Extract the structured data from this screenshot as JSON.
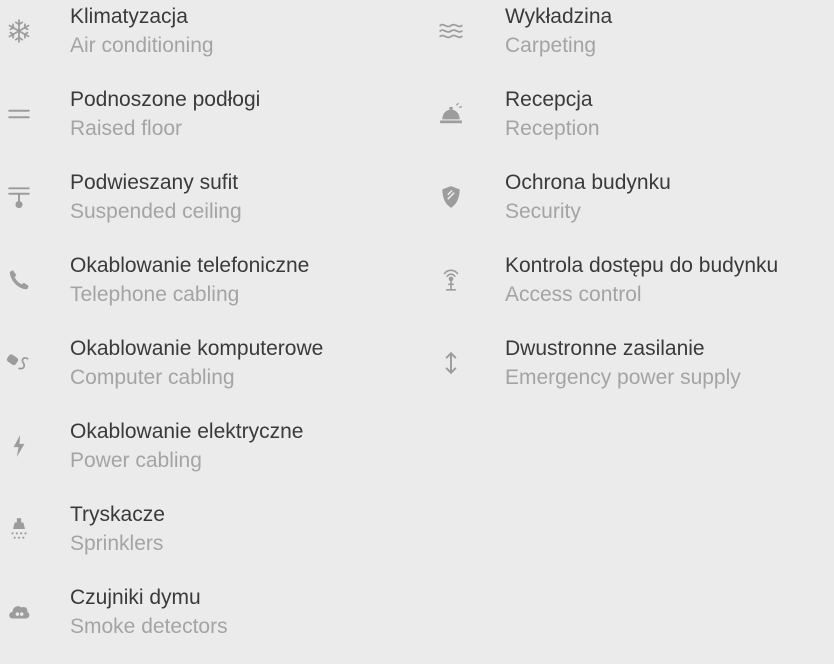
{
  "features_left": [
    {
      "pl": "Klimatyzacja",
      "en": "Air conditioning",
      "icon": "snowflake-icon"
    },
    {
      "pl": "Podnoszone podłogi",
      "en": "Raised floor",
      "icon": "raised-floor-icon"
    },
    {
      "pl": "Podwieszany sufit",
      "en": "Suspended ceiling",
      "icon": "suspended-ceiling-icon"
    },
    {
      "pl": "Okablowanie telefoniczne",
      "en": "Telephone cabling",
      "icon": "phone-icon"
    },
    {
      "pl": "Okablowanie komputerowe",
      "en": "Computer cabling",
      "icon": "network-cable-icon"
    },
    {
      "pl": "Okablowanie elektryczne",
      "en": "Power cabling",
      "icon": "lightning-icon"
    },
    {
      "pl": "Tryskacze",
      "en": "Sprinklers",
      "icon": "sprinkler-icon"
    },
    {
      "pl": "Czujniki dymu",
      "en": "Smoke detectors",
      "icon": "smoke-detector-icon"
    }
  ],
  "features_right": [
    {
      "pl": "Wykładzina",
      "en": "Carpeting",
      "icon": "waves-icon"
    },
    {
      "pl": "Recepcja",
      "en": "Reception",
      "icon": "reception-bell-icon"
    },
    {
      "pl": "Ochrona budynku",
      "en": "Security",
      "icon": "shield-icon"
    },
    {
      "pl": "Kontrola dostępu do budynku",
      "en": "Access control",
      "icon": "antenna-icon"
    },
    {
      "pl": "Dwustronne zasilanie",
      "en": "Emergency power supply",
      "icon": "updown-arrow-icon"
    }
  ]
}
